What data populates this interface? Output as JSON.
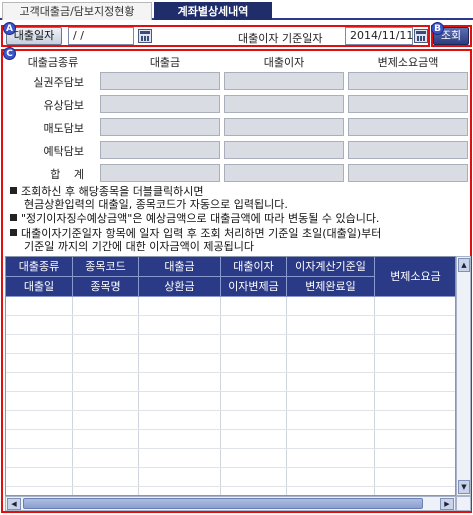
{
  "tabs": [
    {
      "label": "고객대출금/담보지정현황",
      "active": false
    },
    {
      "label": "계좌별상세내역",
      "active": true
    }
  ],
  "badges": {
    "a": "A",
    "b": "B",
    "c": "C"
  },
  "top": {
    "loan_date_button": "대출일자",
    "loan_date_value": " / /",
    "rate_base_label": "대출이자 기준일자",
    "rate_base_value": "2014/11/11",
    "view_button": "조회"
  },
  "summary": {
    "headers": [
      "대출금종류",
      "대출금",
      "대출이자",
      "변제소요금액"
    ],
    "rows": [
      "실권주담보",
      "유상담보",
      "매도담보",
      "예탁담보",
      "합 계"
    ]
  },
  "notes": [
    "조회하신 후 해당종목을 더블클릭하시면",
    "현금상환입력의 대출일, 종목코드가 자동으로 입력됩니다.",
    "\"정기이자징수예상금액\"은 예상금액으로 대출금액에 따라 변동될 수 있습니다.",
    "대출이자기준일자 항목에 일자 입력 후 조회 처리하면 기준일 초일(대출일)부터",
    "기준일 까지의 기간에 대한 이자금액이 제공됩니다"
  ],
  "grid": {
    "top_headers": [
      "대출종류",
      "종목코드",
      "대출금",
      "대출이자",
      "이자계산기준일"
    ],
    "bottom_headers": [
      "대출일",
      "종목명",
      "상환금",
      "이자변제금",
      "변제완료일"
    ],
    "merged_header": "변제소요금"
  },
  "colors": {
    "accent": "#2b3a86",
    "annotation": "#e01010",
    "badge": "#3b54c8"
  },
  "icons": [
    "calendar-icon",
    "scroll-up-arrow-icon",
    "scroll-down-arrow-icon",
    "scroll-left-arrow-icon",
    "scroll-right-arrow-icon",
    "bullet-square-icon"
  ]
}
